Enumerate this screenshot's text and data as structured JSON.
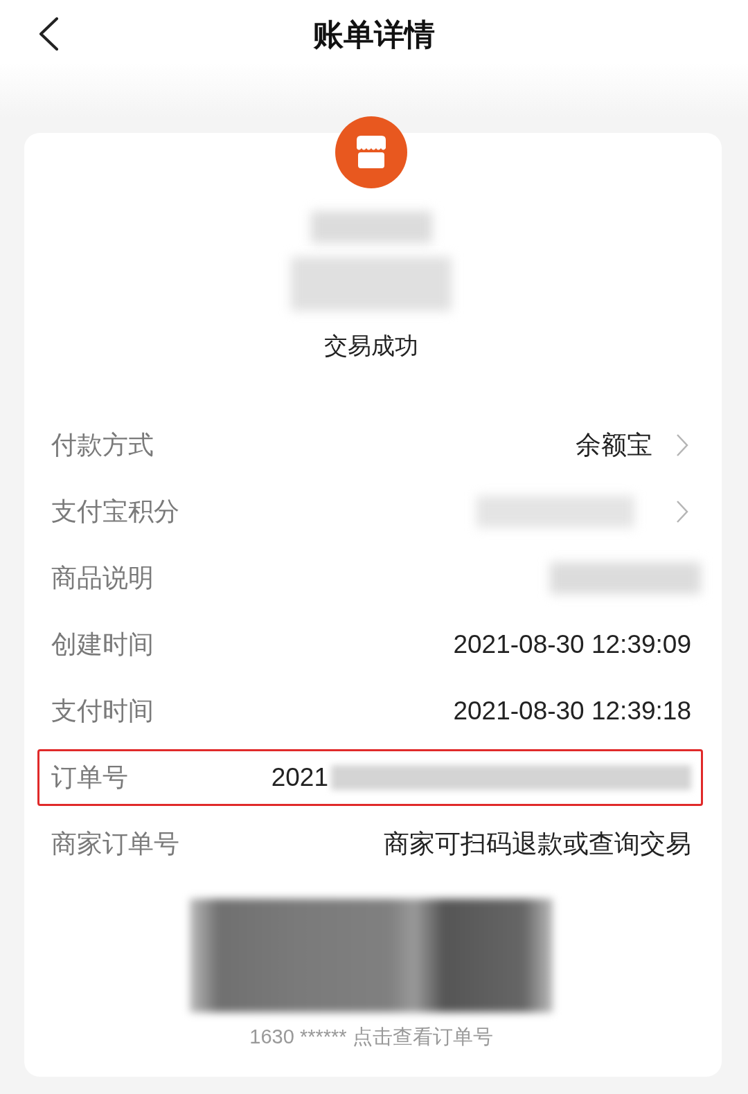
{
  "header": {
    "title": "账单详情"
  },
  "summary": {
    "status": "交易成功"
  },
  "rows": [
    {
      "label": "付款方式",
      "value": "余额宝",
      "redacted": false,
      "chevron": true,
      "highlighted": false
    },
    {
      "label": "支付宝积分",
      "redacted": true,
      "chevron": true,
      "highlighted": false
    },
    {
      "label": "商品说明",
      "redacted": true,
      "chevron": false,
      "highlighted": false
    },
    {
      "label": "创建时间",
      "value": "2021-08-30 12:39:09",
      "redacted": false,
      "chevron": false,
      "highlighted": false
    },
    {
      "label": "支付时间",
      "value": "2021-08-30 12:39:18",
      "redacted": false,
      "chevron": false,
      "highlighted": false
    },
    {
      "label": "订单号",
      "value": "2021",
      "redacted": true,
      "chevron": false,
      "highlighted": true
    },
    {
      "label": "商家订单号",
      "value": "商家可扫码退款或查询交易",
      "redacted": false,
      "chevron": false,
      "highlighted": false
    }
  ],
  "barcode": {
    "caption": "1630 ****** 点击查看订单号"
  }
}
